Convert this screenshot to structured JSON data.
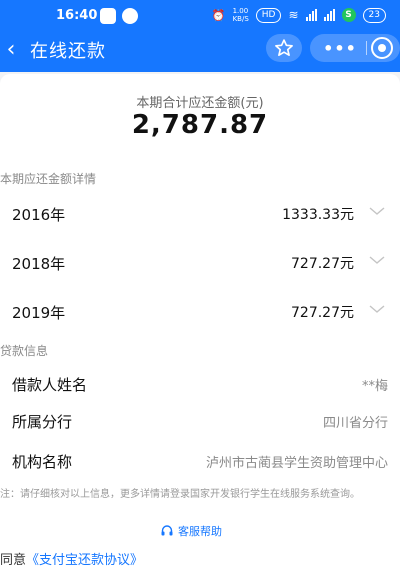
{
  "status": {
    "time": "16:40",
    "net_speed": "1.00\nKB/S",
    "hd": "HD",
    "sim_badge": "S",
    "battery": "23"
  },
  "header": {
    "back_glyph": "‹",
    "title": "在线还款",
    "more_glyph": "•••"
  },
  "summary": {
    "label": "本期合计应还金额(元)",
    "amount": "2,787.87"
  },
  "detail": {
    "title": "本期应还金额详情",
    "rows": [
      {
        "year": "2016年",
        "amount": "1333.33元"
      },
      {
        "year": "2018年",
        "amount": "727.27元"
      },
      {
        "year": "2019年",
        "amount": "727.27元"
      }
    ]
  },
  "loan": {
    "title": "贷款信息",
    "rows": [
      {
        "label": "借款人姓名",
        "value": "**梅"
      },
      {
        "label": "所属分行",
        "value": "四川省分行"
      },
      {
        "label": "机构名称",
        "value": "泸州市古蔺县学生资助管理中心"
      }
    ]
  },
  "note": "注：请仔细核对以上信息，更多详情请登录国家开发银行学生在线服务系统查询。",
  "help": "客服帮助",
  "agree": {
    "prefix": "同意",
    "link": "《支付宝还款协议》"
  },
  "colors": {
    "brand": "#1677ff",
    "muted": "#8a8a8a"
  }
}
